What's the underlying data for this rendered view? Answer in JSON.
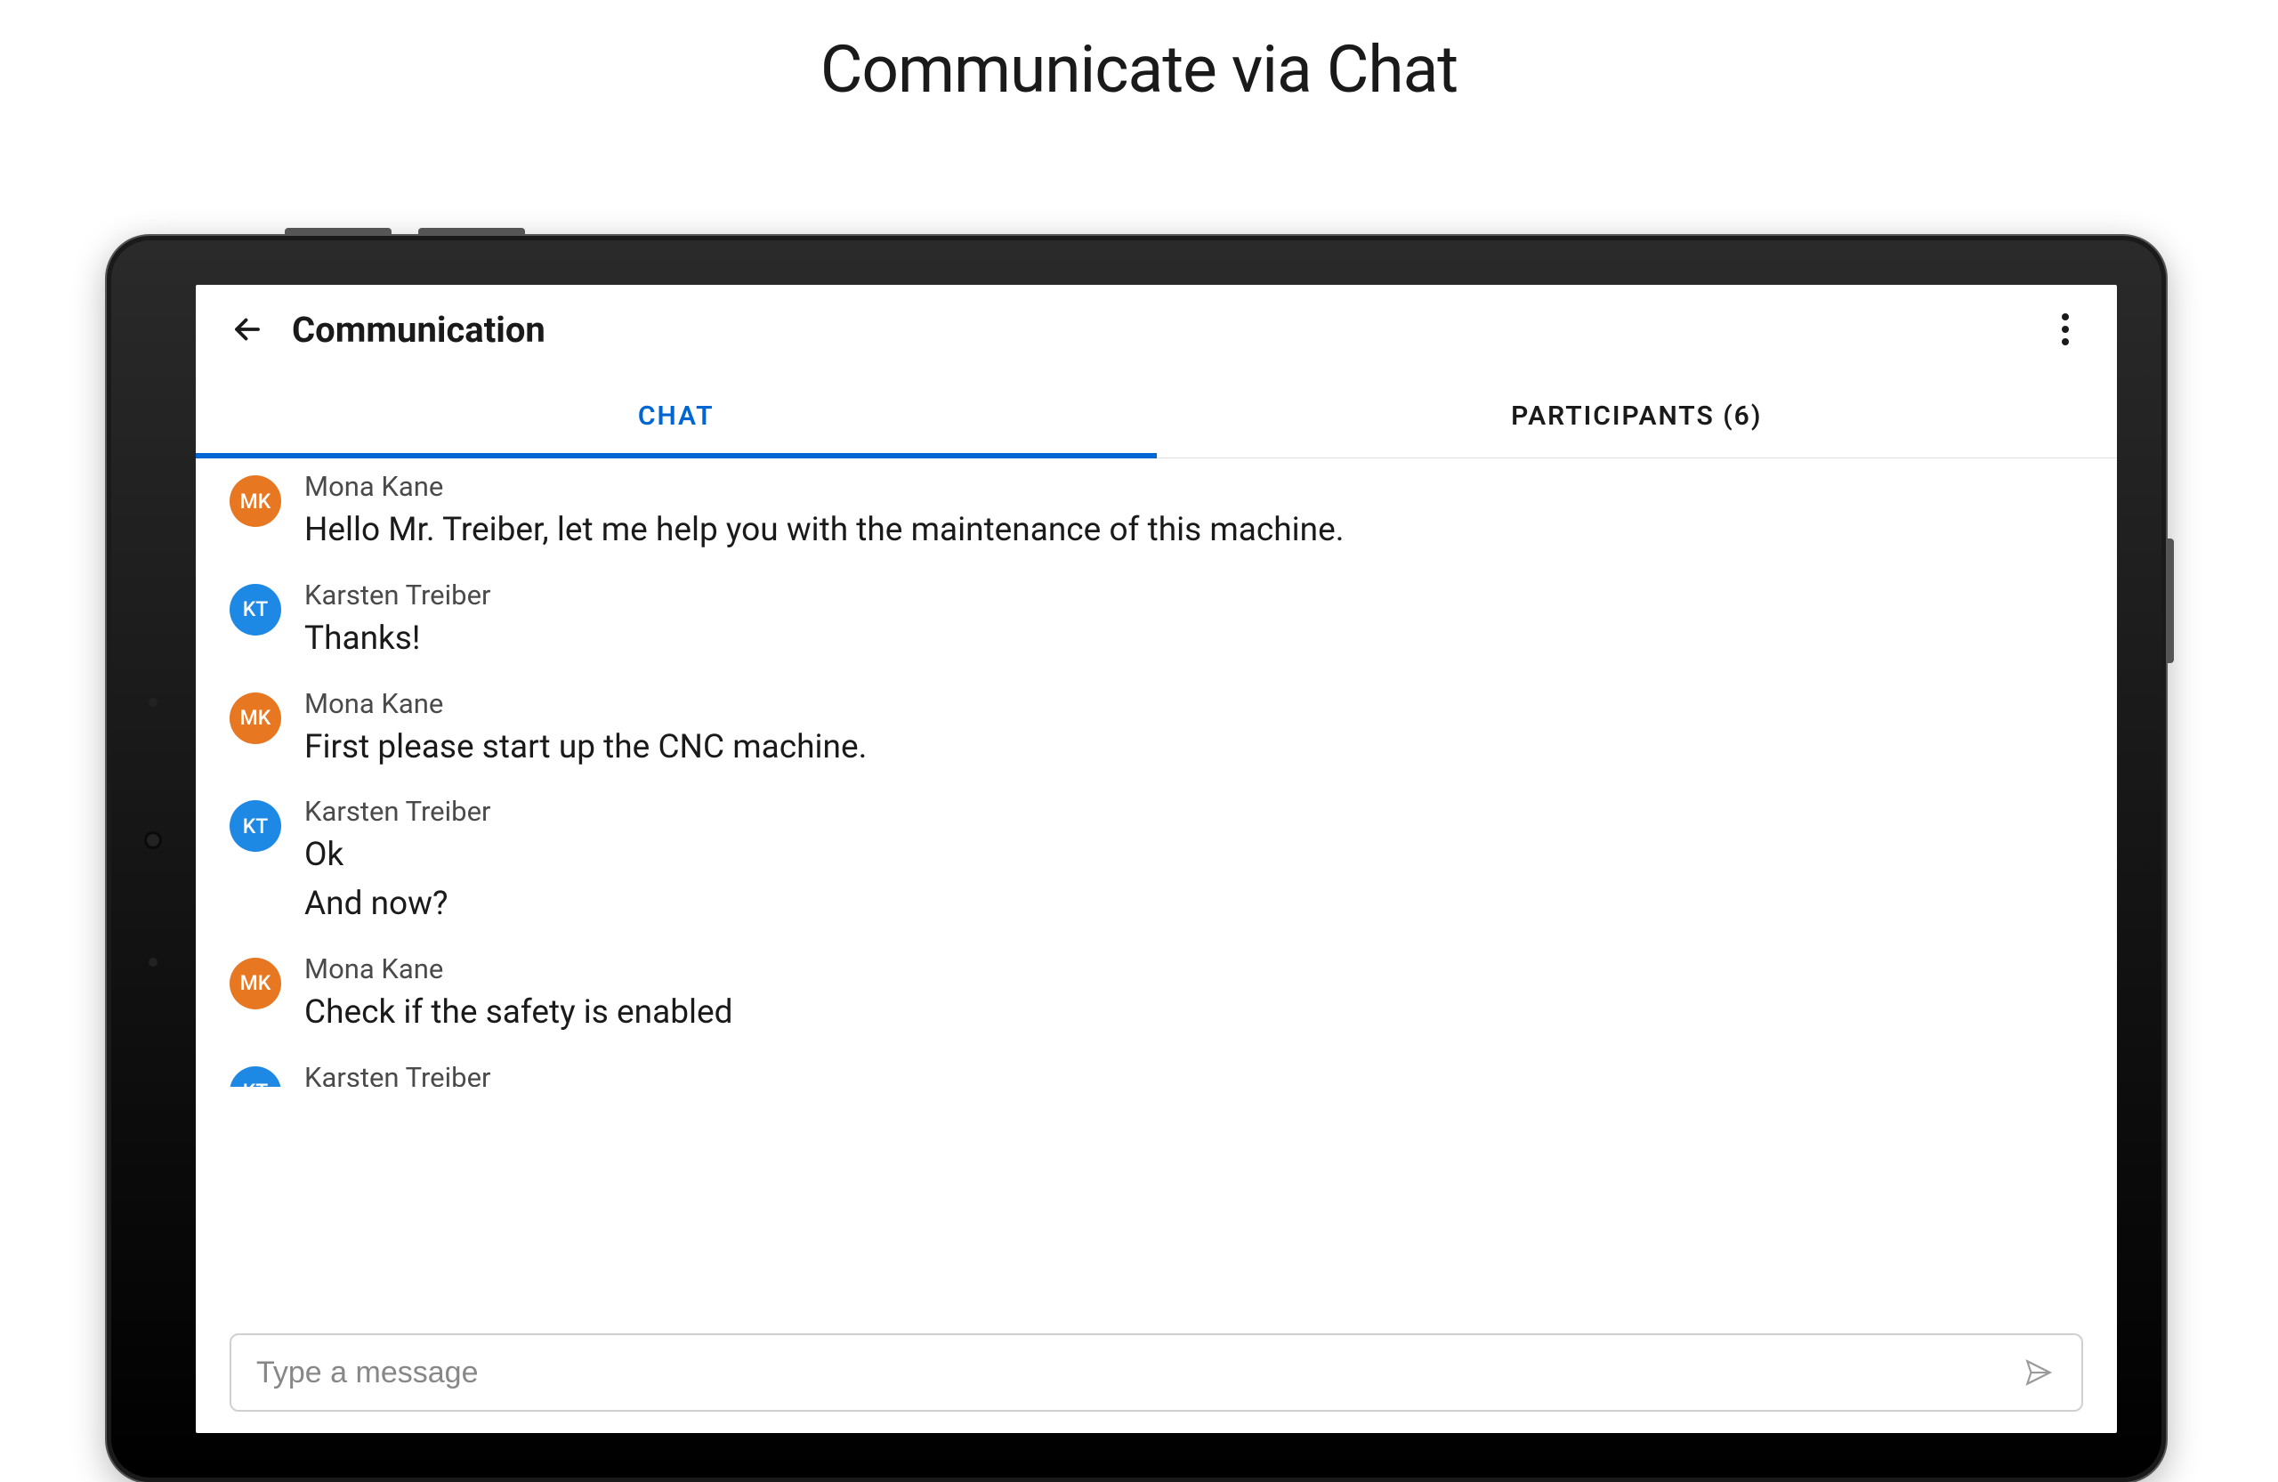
{
  "page_heading": "Communicate via Chat",
  "header": {
    "title": "Communication"
  },
  "tabs": {
    "chat_label": "CHAT",
    "participants_label": "PARTICIPANTS (6)"
  },
  "participants": {
    "mona": {
      "name": "Mona Kane",
      "initials": "MK",
      "color": "orange"
    },
    "karsten": {
      "name": "Karsten Treiber",
      "initials": "KT",
      "color": "blue"
    }
  },
  "messages": [
    {
      "sender": "mona",
      "text": "Hello Mr. Treiber, let me help you with the maintenance of this machine."
    },
    {
      "sender": "karsten",
      "text": "Thanks!"
    },
    {
      "sender": "mona",
      "text": "First please start up the CNC machine."
    },
    {
      "sender": "karsten",
      "text": "Ok\nAnd now?"
    },
    {
      "sender": "mona",
      "text": "Check if the safety is enabled"
    },
    {
      "sender": "karsten",
      "text": ""
    }
  ],
  "composer": {
    "placeholder": "Type a message"
  },
  "colors": {
    "accent": "#0066d4",
    "avatar_orange": "#e87722",
    "avatar_blue": "#1e88e5"
  }
}
